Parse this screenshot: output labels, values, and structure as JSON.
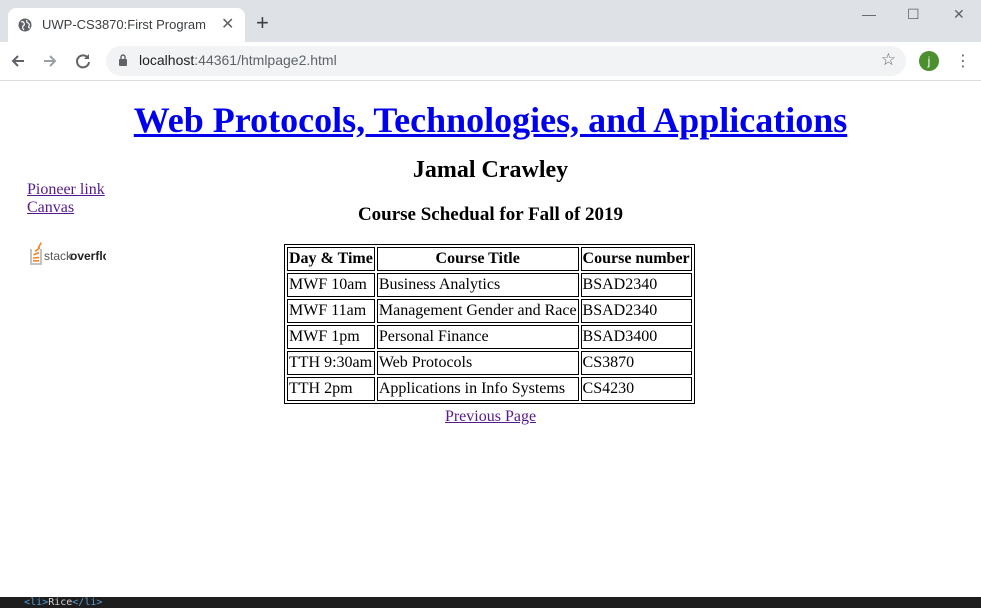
{
  "browser": {
    "tab_title": "UWP-CS3870:First Program",
    "tab_close_glyph": "✕",
    "new_tab_glyph": "+",
    "window_controls": {
      "minimize": "—",
      "maximize": "☐",
      "close": "✕"
    },
    "url_host": "localhost",
    "url_rest": ":44361/htmlpage2.html",
    "avatar_letter": "j",
    "avatar_color": "#4c8f2e",
    "icons": [
      "globe-icon",
      "back-arrow-icon",
      "forward-arrow-icon",
      "reload-icon",
      "lock-icon",
      "star-icon",
      "menu-dots-icon"
    ]
  },
  "page": {
    "heading": "Web Protocols, Technologies, and Applications",
    "author": "Jamal Crawley",
    "subheading": "Course Schedual for Fall of 2019",
    "side_links": [
      {
        "label": "Pioneer link"
      },
      {
        "label": "Canvas"
      }
    ],
    "logo_text_stack": "stack",
    "logo_text_overflow": "overflow",
    "table": {
      "headers": [
        "Day & Time",
        "Course Title",
        "Course number"
      ],
      "rows": [
        [
          "MWF 10am",
          "Business Analytics",
          "BSAD2340"
        ],
        [
          "MWF 11am",
          "Management Gender and Race",
          "BSAD2340"
        ],
        [
          "MWF 1pm",
          "Personal Finance",
          "BSAD3400"
        ],
        [
          "TTH 9:30am",
          "Web Protocols",
          "CS3870"
        ],
        [
          "TTH 2pm",
          "Applications in Info Systems",
          "CS4230"
        ]
      ]
    },
    "previous_link": "Previous Page"
  },
  "devbar": {
    "open_tag": "<li>",
    "text": "Rice",
    "close_tag": "</li>"
  }
}
